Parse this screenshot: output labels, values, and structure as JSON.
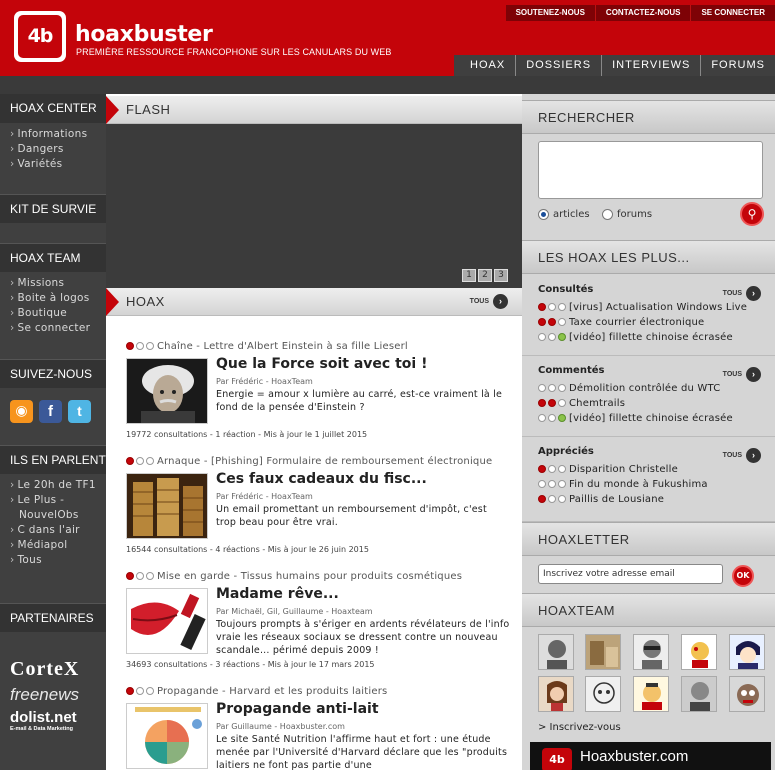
{
  "header": {
    "logo_text": "4b",
    "site_name": "hoaxbuster",
    "tagline": "PREMIÈRE RESSOURCE FRANCOPHONE SUR LES CANULARS DU WEB",
    "top_links": [
      "SOUTENEZ-NOUS",
      "CONTACTEZ-NOUS",
      "SE CONNECTER"
    ],
    "nav": [
      "HOAX",
      "DOSSIERS",
      "INTERVIEWS",
      "FORUMS"
    ]
  },
  "sidebar": {
    "hoax_center": {
      "title": "HOAX CENTER",
      "items": [
        "Informations",
        "Dangers",
        "Variétés"
      ]
    },
    "kit": {
      "title": "KIT DE SURVIE"
    },
    "team": {
      "title": "HOAX TEAM",
      "items": [
        "Missions",
        "Boite à logos",
        "Boutique",
        "Se connecter"
      ]
    },
    "follow": {
      "title": "SUIVEZ-NOUS"
    },
    "press": {
      "title": "ILS EN PARLENT",
      "items": [
        "Le 20h de TF1",
        "Le Plus - NouvelObs",
        "C dans l'air",
        "Médiapol",
        "Tous"
      ]
    },
    "partners": {
      "title": "PARTENAIRES",
      "names": [
        "CorteX",
        "freenews",
        "dolist.net",
        "E-mail & Data Marketing"
      ]
    }
  },
  "center": {
    "flash_title": "FLASH",
    "pager": [
      "1",
      "2",
      "3"
    ],
    "hoax_title": "HOAX",
    "tous": "TOUS",
    "articles": [
      {
        "category": "Chaîne - Lettre d'Albert Einstein à sa fille Lieserl",
        "title": "Que la Force soit avec toi !",
        "byline": "Par Frédéric - HoaxTeam",
        "description": "Energie = amour x lumière au carré, est-ce vraiment là le fond de la pensée d'Einstein ?",
        "meta": "19772 consultations - 1 réaction - Mis à jour le 1 juillet 2015"
      },
      {
        "category": "Arnaque - [Phishing] Formulaire de remboursement électronique",
        "title": "Ces faux cadeaux du fisc...",
        "byline": "Par Frédéric - HoaxTeam",
        "description": "Un email promettant un remboursement d'impôt, c'est trop beau pour être vrai.",
        "meta": "16544 consultations - 4 réactions - Mis à jour le 26 juin 2015"
      },
      {
        "category": "Mise en garde - Tissus humains pour produits cosmétiques",
        "title": "Madame rêve...",
        "byline": "Par Michaël, Gil, Guillaume - Hoaxteam",
        "description": "Toujours prompts à s'ériger en ardents révélateurs de l'info vraie les réseaux sociaux se dressent contre un nouveau scandale... périmé depuis 2009 !",
        "meta": "34693 consultations - 3 réactions - Mis à jour le 17 mars 2015"
      },
      {
        "category": "Propagande - Harvard et les produits laitiers",
        "title": "Propagande anti-lait",
        "byline": "Par Guillaume - Hoaxbuster.com",
        "description": "Le site Santé Nutrition l'affirme haut et fort : une étude menée par l'Université d'Harvard déclare que les \"produits laitiers ne font pas partie d'une",
        "meta": ""
      }
    ]
  },
  "right": {
    "search_title": "RECHERCHER",
    "radio_articles": "articles",
    "radio_forums": "forums",
    "popular_title": "LES HOAX LES PLUS...",
    "consultes": {
      "title": "Consultés",
      "items": [
        "[virus] Actualisation Windows Live",
        "Taxe courrier électronique",
        "[vidéo] fillette chinoise écrasée"
      ]
    },
    "commentes": {
      "title": "Commentés",
      "items": [
        "Démolition contrôlée du WTC",
        "Chemtrails",
        "[vidéo] fillette chinoise écrasée"
      ]
    },
    "apprecies": {
      "title": "Appréciés",
      "items": [
        "Disparition Christelle",
        "Fin du monde à Fukushima",
        "Paillis de Lousiane"
      ]
    },
    "newsletter_title": "HOAXLETTER",
    "newsletter_placeholder": "Inscrivez votre adresse email",
    "ok": "OK",
    "team_title": "HOAXTEAM",
    "inscrivez": "> Inscrivez-vous",
    "promo_text": "Hoaxbuster.com"
  },
  "colors": {
    "brand_red": "#c4040a",
    "sidebar_dark": "#404040",
    "panel_gray": "#d5d5d5"
  }
}
